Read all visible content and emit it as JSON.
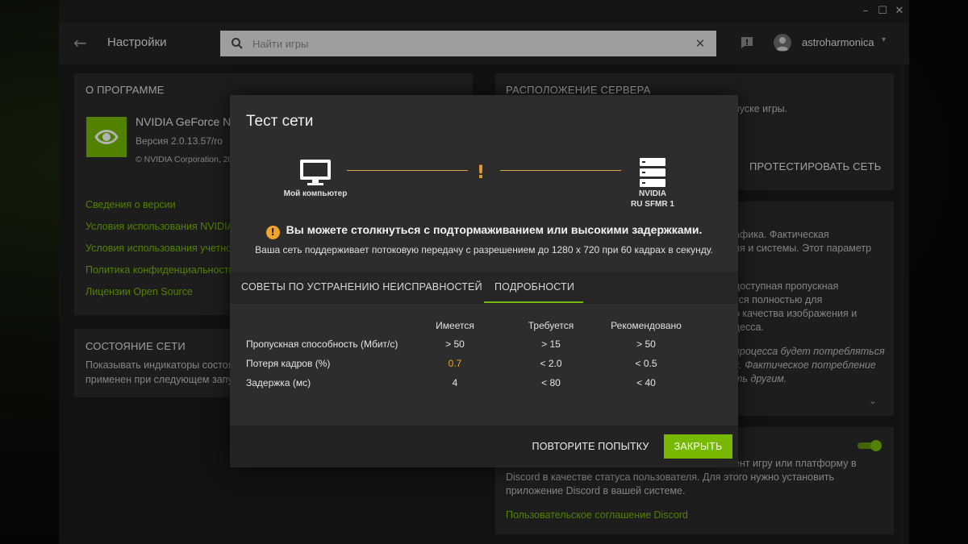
{
  "window": {
    "minimize": "–",
    "maximize": "☐",
    "close": "✕"
  },
  "header": {
    "back": "←",
    "title": "Настройки",
    "search": {
      "value": "",
      "placeholder": "Найти игры",
      "clear": "✕"
    },
    "username": "astroharmonica",
    "caret": "▾"
  },
  "about_panel": {
    "title": "О ПРОГРАММЕ",
    "app_name": "NVIDIA GeForce N",
    "version": "Версия 2.0.13.57/ro",
    "copyright": "© NVIDIA Corporation, 20",
    "links": [
      "Сведения о версии",
      "Условия использования NVIDIA",
      "Условия использования учетно",
      "Политика конфиденциальности",
      "Лицензии Open Source"
    ]
  },
  "network_panel": {
    "title": "СОСТОЯНИЕ СЕТИ",
    "text_line1": "Показывать индикаторы состоя",
    "text_line2": "применен при следующем запус"
  },
  "server_panel": {
    "title": "РАСПОЛОЖЕНИЕ СЕРВЕРА",
    "text": "пуске игры.",
    "test_button": "ПРОТЕСТИРОВАТЬ СЕТЬ"
  },
  "quality_panel": {
    "lines": [
      "афика. Фактическая",
      "ия и системы. Этот параметр",
      "",
      "доступная пропускная",
      "тся полностью для",
      "о качества изображения и",
      "цесса.",
      "",
      "процесса будет потребляться",
      "с. Фактическое потребление",
      "ть другим."
    ],
    "chevron": "⌄"
  },
  "discord_panel": {
    "line1": "ент игру или платформу в",
    "line2": "Discord в качестве статуса пользователя. Для этого нужно установить",
    "line3": "приложение Discord в вашей системе.",
    "link": "Пользовательское соглашение Discord",
    "toggle_on": true
  },
  "modal": {
    "title": "Тест сети",
    "my_computer": "Мой компьютер",
    "server_line1": "NVIDIA",
    "server_line2": "RU SFMR 1",
    "warn_mark": "!",
    "warning": "Вы можете столкнуться с подтормаживанием или высокими задержками.",
    "subwarning": "Ваша сеть поддерживает потоковую передачу с разрешением до 1280 x 720 при 60 кадрах в секунду.",
    "tabs": [
      "СОВЕТЫ ПО УСТРАНЕНИЮ НЕИСПРАВНОСТЕЙ",
      "ПОДРОБНОСТИ"
    ],
    "active_tab": "ПОДРОБНОСТИ",
    "table": {
      "headers": [
        "Имеется",
        "Требуется",
        "Рекомендовано"
      ],
      "rows": [
        {
          "label": "Пропускная способность (Мбит/с)",
          "have": "> 50",
          "required": "> 15",
          "recommended": "> 50"
        },
        {
          "label": "Потеря кадров (%)",
          "have": "0.7",
          "required": "< 2.0",
          "recommended": "< 0.5"
        },
        {
          "label": "Задержка (мс)",
          "have": "4",
          "required": "< 80",
          "recommended": "< 40"
        }
      ]
    },
    "retry_button": "ПОВТОРИТЕ ПОПЫТКУ",
    "close_button": "ЗАКРЫТЬ"
  },
  "colors": {
    "accent": "#76b900",
    "warning": "#f0a428",
    "panel": "#2a2a2a",
    "modal": "#2d2d2d"
  }
}
